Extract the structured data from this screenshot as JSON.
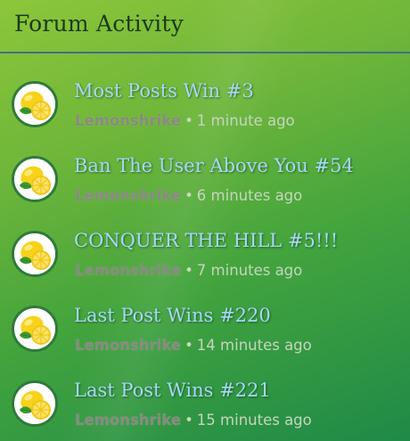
{
  "header": {
    "title": "Forum Activity"
  },
  "items": [
    {
      "title": "Most Posts Win #3",
      "user": "Lemonshrike",
      "separator": "•",
      "time": "1 minute ago"
    },
    {
      "title": "Ban The User Above You #54",
      "user": "Lemonshrike",
      "separator": "•",
      "time": "6 minutes ago"
    },
    {
      "title": "CONQUER THE HILL #5!!!",
      "user": "Lemonshrike",
      "separator": "•",
      "time": "7 minutes ago"
    },
    {
      "title": "Last Post Wins #220",
      "user": "Lemonshrike",
      "separator": "•",
      "time": "14 minutes ago"
    },
    {
      "title": "Last Post Wins #221",
      "user": "Lemonshrike",
      "separator": "•",
      "time": "15 minutes ago"
    }
  ],
  "avatar_icon": "lemon-icon",
  "colors": {
    "title_link": "#a7d8f5",
    "header_text": "#1d3a1a",
    "divider": "#3f6f88",
    "avatar_border": "#2f7a3a"
  }
}
